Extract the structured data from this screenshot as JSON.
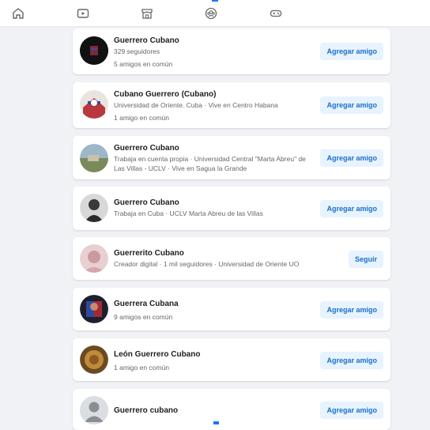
{
  "nav": {
    "items": [
      {
        "icon": "home-icon"
      },
      {
        "icon": "video-icon"
      },
      {
        "icon": "marketplace-icon"
      },
      {
        "icon": "groups-icon"
      },
      {
        "icon": "gaming-icon"
      }
    ],
    "accent": "#1877f2"
  },
  "results": [
    {
      "name": "Guerrero Cubano",
      "line1": "329 seguidores",
      "line2": "5 amigos en común",
      "button": "Agregar amigo"
    },
    {
      "name": "Cubano Guerrero (Cubano)",
      "line1": "Universidad de Oriente. Cuba · Vive en Centro Habana",
      "line2": "1 amigo en común",
      "button": "Agregar amigo"
    },
    {
      "name": "Guerrero Cubano",
      "line1": "Trabaja en cuenta propia · Universidad Central \"Marta Abreu\" de Las Villas - UCLV · Vive en Sagua la Grande",
      "line2": "",
      "button": "Agregar amigo"
    },
    {
      "name": "Guerrero Cubano",
      "line1": "Trabaja en Cuba · UCLV Marta Abreu de las Villas",
      "line2": "",
      "button": "Agregar amigo"
    },
    {
      "name": "Guerrerito Cubano",
      "line1": "Creador digital · 1 mil seguidores · Universidad de Oriente UO",
      "line2": "",
      "button": "Seguir"
    },
    {
      "name": "Guerrera Cubana",
      "line1": "9 amigos en común",
      "line2": "",
      "button": "Agregar amigo"
    },
    {
      "name": "León Guerrero Cubano",
      "line1": "1 amigo en común",
      "line2": "",
      "button": "Agregar amigo"
    },
    {
      "name": "Guerrero cubano",
      "line1": "",
      "line2": "",
      "button": "Agregar amigo"
    }
  ]
}
